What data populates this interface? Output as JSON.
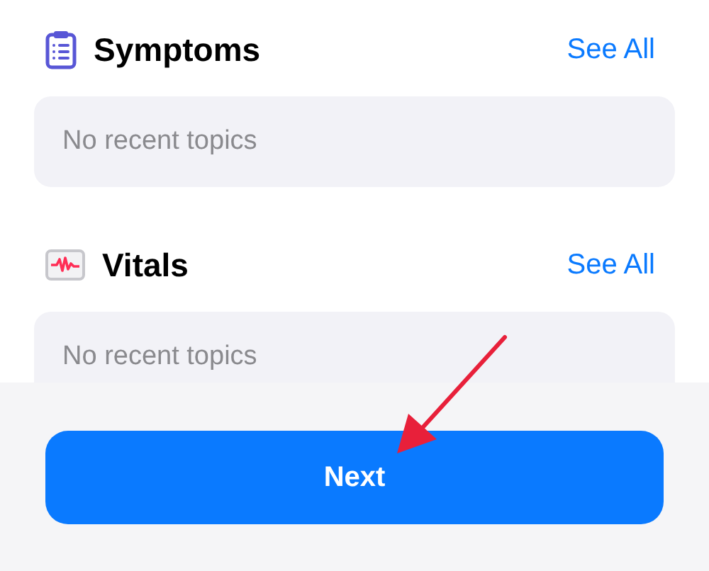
{
  "sections": [
    {
      "title": "Symptoms",
      "link": "See All",
      "empty_text": "No recent topics"
    },
    {
      "title": "Vitals",
      "link": "See All",
      "empty_text": "No recent topics"
    }
  ],
  "next_button": "Next"
}
